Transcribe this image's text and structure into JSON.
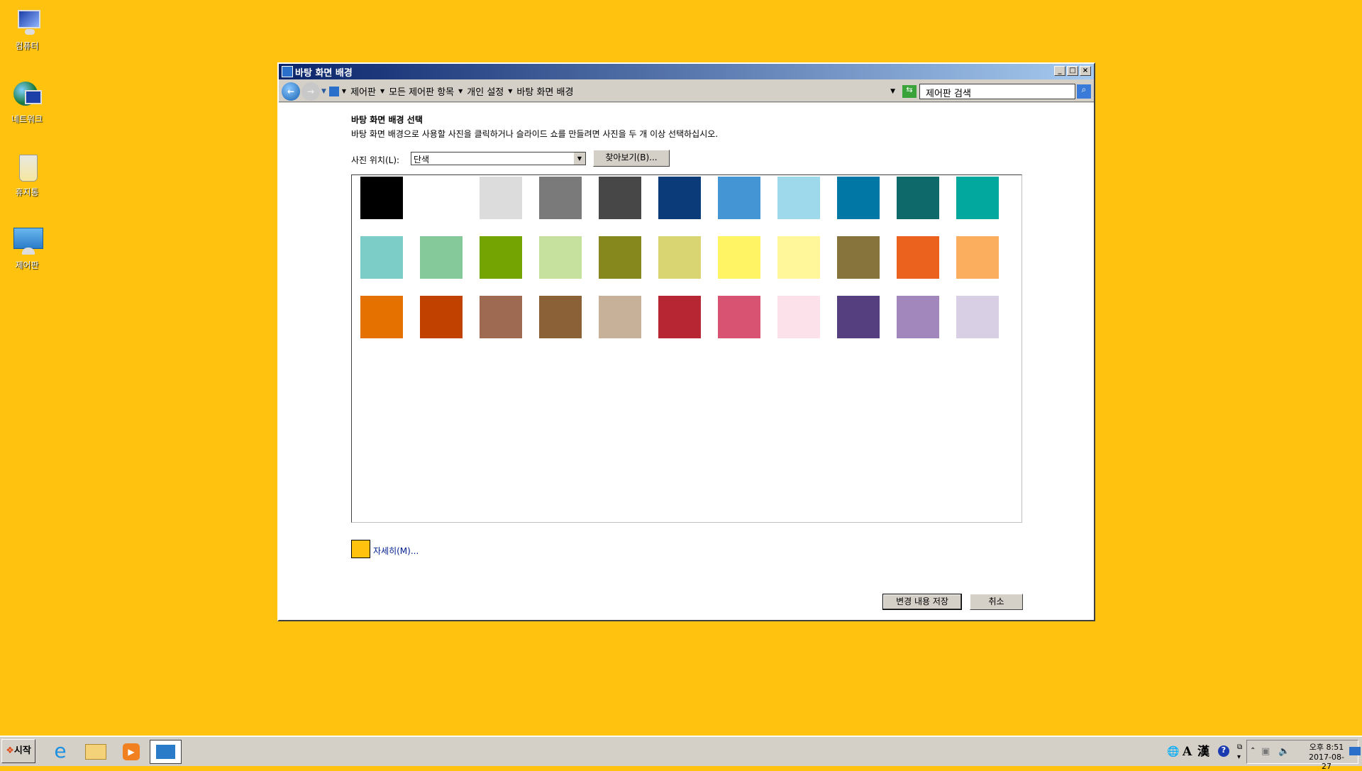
{
  "desktop": {
    "icons": [
      {
        "label": "컴퓨터",
        "icon": "computer-icon"
      },
      {
        "label": "네트워크",
        "icon": "network-icon"
      },
      {
        "label": "휴지통",
        "icon": "recycle-bin-icon"
      },
      {
        "label": "제어판",
        "icon": "control-panel-icon"
      }
    ]
  },
  "window": {
    "title": "바탕 화면 배경",
    "breadcrumbs": [
      "제어판",
      "모든 제어판 항목",
      "개인 설정",
      "바탕 화면 배경"
    ],
    "search_placeholder": "제어판 검색",
    "heading": "바탕 화면 배경 선택",
    "description": "바탕 화면 배경으로 사용할 사진을 클릭하거나 슬라이드 쇼를 만들려면 사진을 두 개 이상 선택하십시오.",
    "location_label": "사진 위치(L):",
    "location_value": "단색",
    "browse_label": "찾아보기(B)...",
    "colors": [
      [
        "#000000",
        "#ffffff",
        "#dcdcdc",
        "#7a7a7a",
        "#474747",
        "#0b3b78",
        "#4396d3",
        "#9dd9ea",
        "#0077a5",
        "#0e696b",
        "#02a89e"
      ],
      [
        "#7ccdc8",
        "#85c99b",
        "#74a402",
        "#c6e09e",
        "#86881e",
        "#d9d572",
        "#fff463",
        "#fff799",
        "#87733c",
        "#eb611e",
        "#fbae5e"
      ],
      [
        "#e57200",
        "#c04100",
        "#9e6a52",
        "#8b6137",
        "#c8b199",
        "#b72733",
        "#d85372",
        "#fce0ea",
        "#553f7e",
        "#a287bc",
        "#d8cfe4"
      ]
    ],
    "current_color": "#ffc20e",
    "more_label": "자세히(M)...",
    "save_label": "변경 내용 저장",
    "cancel_label": "취소"
  },
  "taskbar": {
    "start_label": "시작",
    "apps": [
      "internet-explorer-icon",
      "explorer-icon",
      "media-player-icon",
      "control-panel-icon"
    ],
    "ime": [
      "A",
      "漢"
    ],
    "time": "오후 8:51",
    "date": "2017-08-27"
  }
}
